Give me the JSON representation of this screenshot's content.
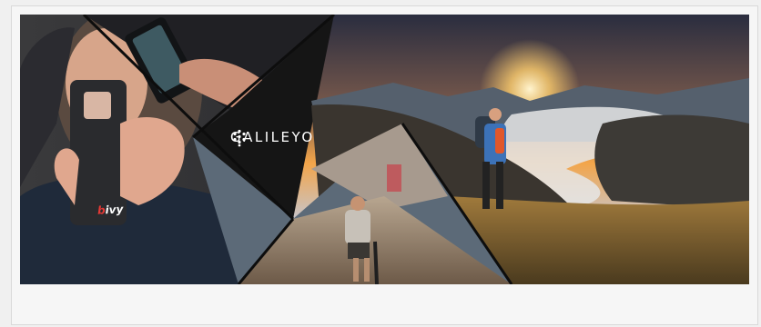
{
  "banner": {
    "logo_text": "GALILEYO",
    "logo_icon": "hexagon-dots-icon",
    "device_brand_first": "b",
    "device_brand_rest": "ivy",
    "colors": {
      "sky_top": "#2a2d3f",
      "sunset": "#f3a54a",
      "mountain": "#3a352f",
      "grass": "#8a6b34",
      "flood_water": "#8c7662",
      "logo_panel": "#151515",
      "device_accent": "#e53935"
    }
  }
}
